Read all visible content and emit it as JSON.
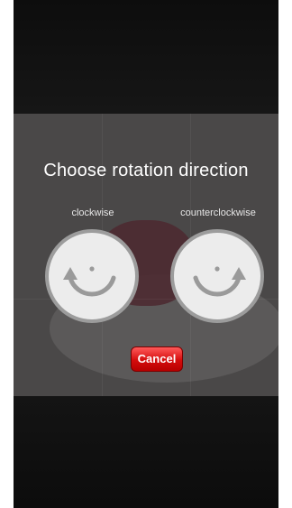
{
  "dialog": {
    "title": "Choose rotation direction",
    "options": [
      {
        "label": "clockwise",
        "icon": "rotate-clockwise-icon"
      },
      {
        "label": "counterclockwise",
        "icon": "rotate-counterclockwise-icon"
      }
    ],
    "cancel_label": "Cancel"
  },
  "colors": {
    "overlay": "#4a4848",
    "button_face": "#ececec",
    "button_ring": "#9c9c9c",
    "cancel": "#d40c0c"
  }
}
